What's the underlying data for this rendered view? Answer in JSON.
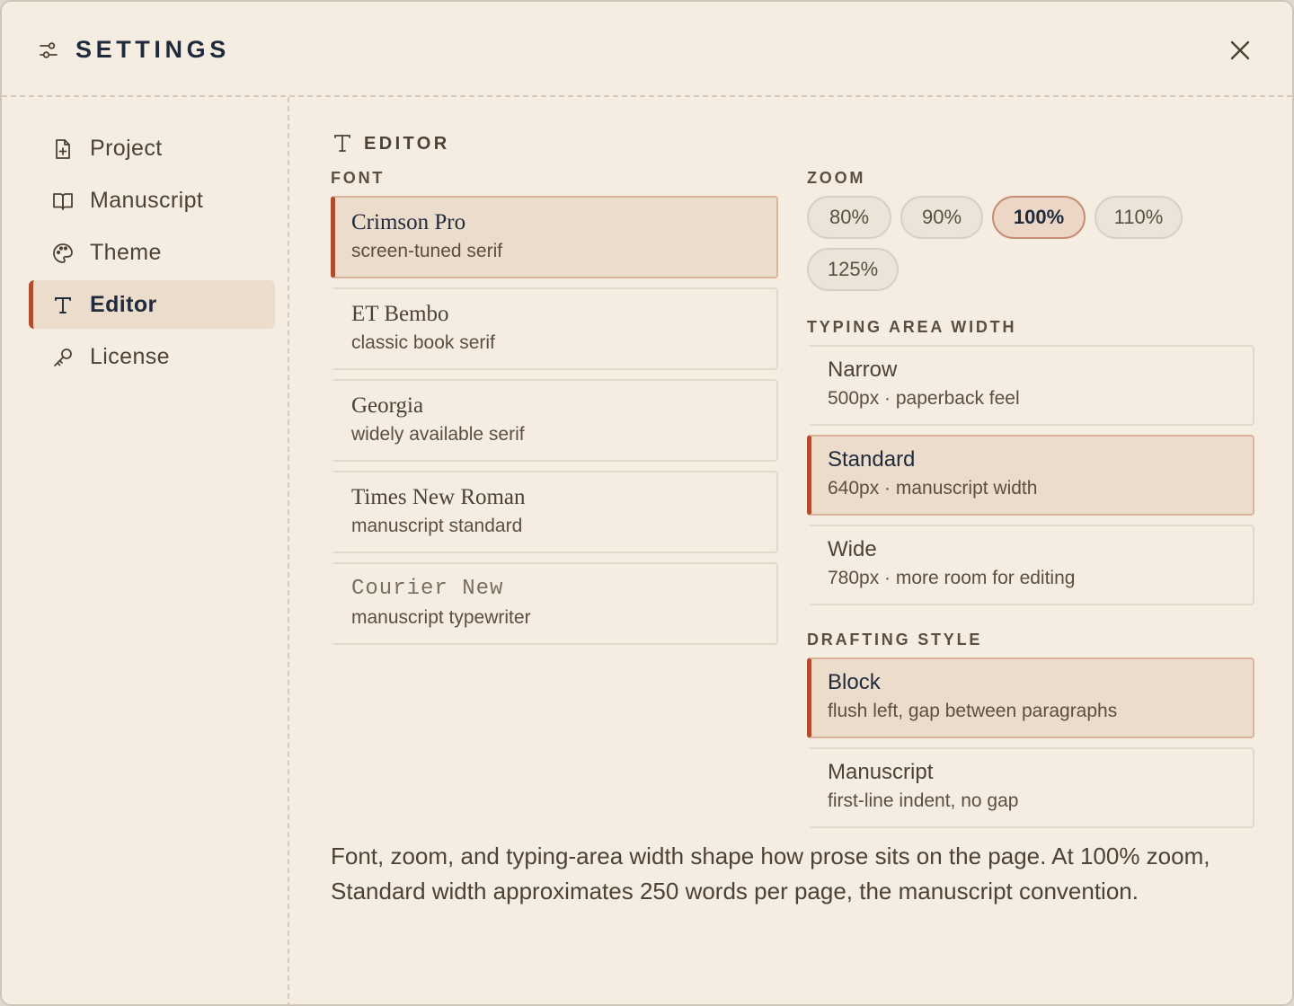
{
  "header": {
    "title": "SETTINGS",
    "settings_icon": "sliders-icon",
    "close_icon": "close-icon"
  },
  "sidebar": {
    "items": [
      {
        "label": "Project",
        "icon": "file-plus-icon"
      },
      {
        "label": "Manuscript",
        "icon": "book-open-icon"
      },
      {
        "label": "Theme",
        "icon": "palette-icon"
      },
      {
        "label": "Editor",
        "icon": "type-icon",
        "active": true
      },
      {
        "label": "License",
        "icon": "key-icon"
      }
    ]
  },
  "section": {
    "title": "EDITOR",
    "icon": "type-icon"
  },
  "font": {
    "label": "FONT",
    "options": [
      {
        "name": "Crimson Pro",
        "desc": "screen-tuned serif",
        "selected": true
      },
      {
        "name": "ET Bembo",
        "desc": "classic book serif"
      },
      {
        "name": "Georgia",
        "desc": "widely available serif"
      },
      {
        "name": "Times New Roman",
        "desc": "manuscript standard"
      },
      {
        "name": "Courier New",
        "desc": "manuscript typewriter"
      }
    ]
  },
  "zoom": {
    "label": "ZOOM",
    "options": [
      "80%",
      "90%",
      "100%",
      "110%",
      "125%"
    ],
    "selected": "100%"
  },
  "typing_width": {
    "label": "TYPING AREA WIDTH",
    "options": [
      {
        "name": "Narrow",
        "desc": "500px · paperback feel"
      },
      {
        "name": "Standard",
        "desc": "640px · manuscript width",
        "selected": true
      },
      {
        "name": "Wide",
        "desc": "780px · more room for editing"
      }
    ]
  },
  "drafting": {
    "label": "DRAFTING STYLE",
    "options": [
      {
        "name": "Block",
        "desc": "flush left, gap between paragraphs",
        "selected": true
      },
      {
        "name": "Manuscript",
        "desc": "first-line indent, no gap"
      }
    ]
  },
  "description": "Font, zoom, and typing-area width shape how prose sits on the page. At 100% zoom, Standard width approximates 250 words per page, the manuscript convention.",
  "colors": {
    "accent": "#b24a2c",
    "background": "#f5ede1",
    "selected_bg": "#ecdccb",
    "title": "#1f2a3d"
  }
}
